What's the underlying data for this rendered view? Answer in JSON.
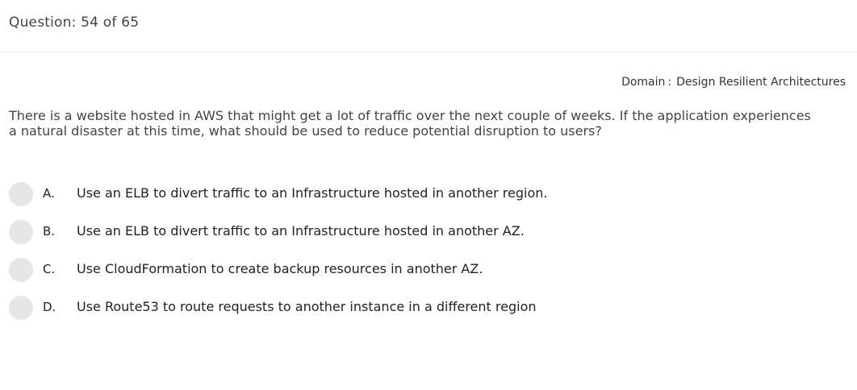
{
  "header": {
    "question_counter": "Question: 54 of 65"
  },
  "domain": {
    "label": "Domain",
    "separator": ":",
    "value": "Design Resilient Architectures"
  },
  "question": {
    "text": "There is a website hosted in AWS that might get a lot of traffic over the next couple of weeks. If the application experiences a natural disaster at this time, what should be used to reduce potential disruption to users?"
  },
  "options": [
    {
      "letter": "A.",
      "text": "Use an ELB to divert traffic to an Infrastructure hosted in another region."
    },
    {
      "letter": "B.",
      "text": "Use an ELB to divert traffic to an Infrastructure hosted in another AZ."
    },
    {
      "letter": "C.",
      "text": "Use CloudFormation to create backup resources in another AZ."
    },
    {
      "letter": "D.",
      "text": "Use Route53 to route requests to another instance in a different region"
    }
  ],
  "colors": {
    "radio": "#e6e6e6",
    "divider": "#efefef"
  }
}
